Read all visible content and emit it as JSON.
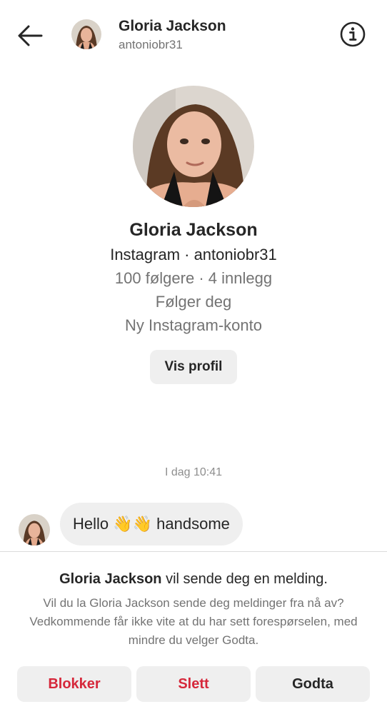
{
  "header": {
    "name": "Gloria Jackson",
    "username": "antoniobr31"
  },
  "profile": {
    "name": "Gloria Jackson",
    "line_platform": "Instagram · antoniobr31",
    "line_stats": "100 følgere · 4 innlegg",
    "line_follows": "Følger deg",
    "line_account": "Ny Instagram-konto",
    "view_profile_label": "Vis profil"
  },
  "conversation": {
    "timestamp": "I dag 10:41",
    "messages": [
      {
        "text": "Hello 👋👋 handsome"
      }
    ]
  },
  "request": {
    "title_name": "Gloria Jackson",
    "title_rest": " vil sende deg en melding.",
    "body": "Vil du la Gloria Jackson sende deg meldinger fra nå av? Vedkommende får ikke vite at du har sett forespørselen, med mindre du velger Godta.",
    "block_label": "Blokker",
    "delete_label": "Slett",
    "accept_label": "Godta"
  },
  "colors": {
    "danger": "#d6283b",
    "secondary_text": "#737373",
    "button_bg": "#efefef"
  },
  "icons": {
    "back": "arrow-left-icon",
    "info": "info-circle-icon"
  }
}
